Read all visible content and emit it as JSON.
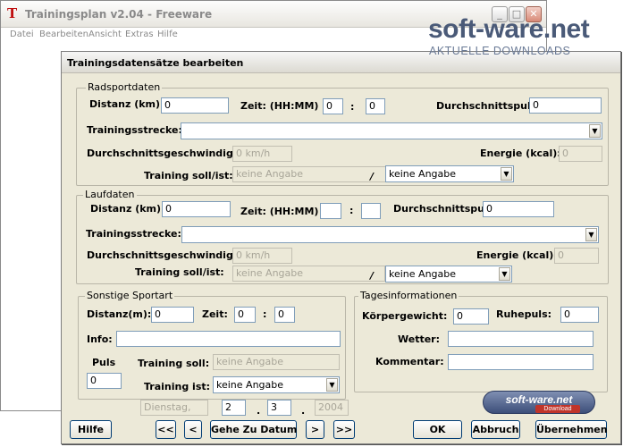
{
  "main_window": {
    "title": "Trainingsplan v2.04 - Freeware",
    "icon": "T",
    "menu": [
      "Datei",
      "Bearbeiten",
      "Ansicht",
      "Extras",
      "Hilfe"
    ],
    "caption_buttons": [
      "minimize-icon",
      "maximize-icon",
      "close-icon"
    ]
  },
  "watermark": {
    "brand": "soft-ware.net",
    "tagline": "AKTUELLE DOWNLOADS",
    "badge_brand": "soft-ware.net",
    "badge_label": "Download"
  },
  "dialog": {
    "title": "Trainingsdatensätze bearbeiten",
    "rad": {
      "title": "Radsportdaten",
      "distanz_label": "Distanz (km):",
      "distanz_value": "0",
      "zeit_label": "Zeit: (HH:MM)",
      "zeit_hh": "0",
      "zeit_sep": ":",
      "zeit_mm": "0",
      "puls_label": "Durchschnittspuls:",
      "puls_value": "0",
      "strecke_label": "Trainingsstrecke:",
      "strecke_value": "",
      "geschw_label": "Durchschnittsgeschwindigkeit:",
      "geschw_value": "0 km/h",
      "energie_label": "Energie (kcal):",
      "energie_value": "0",
      "soll_ist_label": "Training soll/ist:",
      "soll_value": "keine Angabe",
      "slash": "/",
      "ist_value": "keine Angabe"
    },
    "lauf": {
      "title": "Laufdaten",
      "distanz_label": "Distanz (km):",
      "distanz_value": "0",
      "zeit_label": "Zeit: (HH:MM)",
      "zeit_hh": "",
      "zeit_sep": ":",
      "zeit_mm": "",
      "puls_label": "Durchschnittspuls:",
      "puls_value": "0",
      "strecke_label": "Trainingsstrecke:",
      "strecke_value": "",
      "geschw_label": "Durchschnittsgeschwindigkeit:",
      "geschw_value": "0 km/h",
      "energie_label": "Energie (kcal):",
      "energie_value": "0",
      "soll_ist_label": "Training soll/ist:",
      "soll_value": "keine Angabe",
      "slash": "/",
      "ist_value": "keine Angabe"
    },
    "sonstige": {
      "title": "Sonstige Sportart",
      "distanz_label": "Distanz(m):",
      "distanz_value": "0",
      "zeit_label": "Zeit:",
      "zeit_hh": "0",
      "zeit_sep": ":",
      "zeit_mm": "0",
      "info_label": "Info:",
      "info_value": "",
      "puls_label": "Puls",
      "puls_value": "0",
      "soll_label": "Training soll:",
      "soll_value": "keine Angabe",
      "ist_label": "Training ist:",
      "ist_value": "keine Angabe"
    },
    "tages": {
      "title": "Tagesinformationen",
      "gewicht_label": "Körpergewicht:",
      "gewicht_value": "0",
      "ruhepuls_label": "Ruhepuls:",
      "ruhepuls_value": "0",
      "wetter_label": "Wetter:",
      "wetter_value": "",
      "kommentar_label": "Kommentar:",
      "kommentar_value": ""
    },
    "date": {
      "weekday": "Dienstag,",
      "day": "2",
      "sep1": ".",
      "month": "3",
      "sep2": ".",
      "year": "2004"
    },
    "buttons": {
      "hilfe": "Hilfe",
      "first": "<<",
      "prev": "<",
      "goto": "Gehe Zu Datum",
      "next": ">",
      "last": ">>",
      "ok": "OK",
      "abbruch": "Abbruch",
      "uebernehmen": "Übernehmen"
    }
  }
}
